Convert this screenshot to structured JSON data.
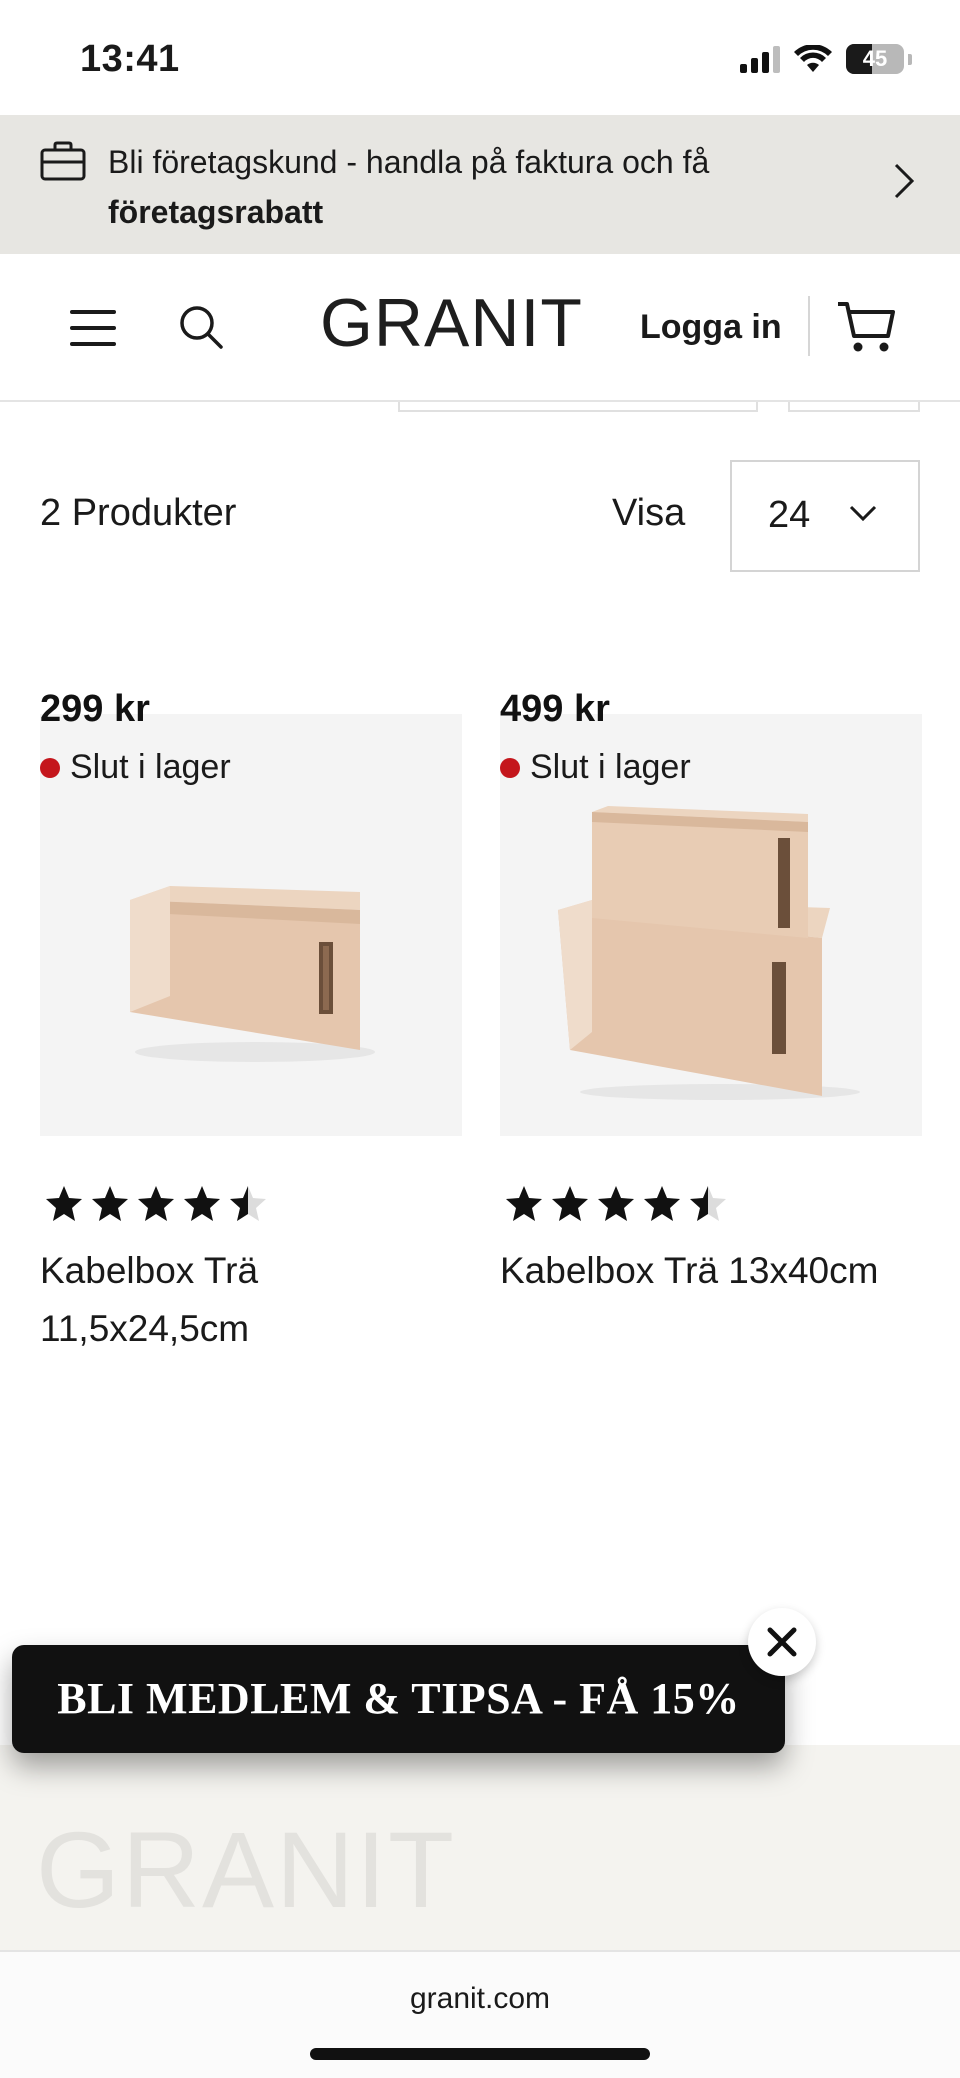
{
  "status_bar": {
    "time": "13:41",
    "battery": "45",
    "battery_level": 0.45
  },
  "promo": {
    "text_line1": "Bli företagskund - handla på faktura och få",
    "text_line2": "företagsrabatt"
  },
  "header": {
    "logo": "GRANIT",
    "login_label": "Logga in"
  },
  "toolbar": {
    "count": "2 Produkter",
    "visa_label": "Visa",
    "per_page": "24"
  },
  "products": [
    {
      "name": "Kabelbox Trä 11,5x24,5cm",
      "price": "299 kr",
      "stock": "Slut i lager",
      "rating": 4.5
    },
    {
      "name": "Kabelbox Trä 13x40cm",
      "price": "499 kr",
      "stock": "Slut i lager",
      "rating": 4.5
    }
  ],
  "popup": {
    "text": "BLI MEDLEM & TIPSA - FÅ 15%"
  },
  "footer": {
    "logo": "GRANIT"
  },
  "browser": {
    "url": "granit.com"
  },
  "colors": {
    "promo_bg": "#e7e6e2",
    "out_of_stock": "#c4161c",
    "popup_bg": "#111111"
  }
}
